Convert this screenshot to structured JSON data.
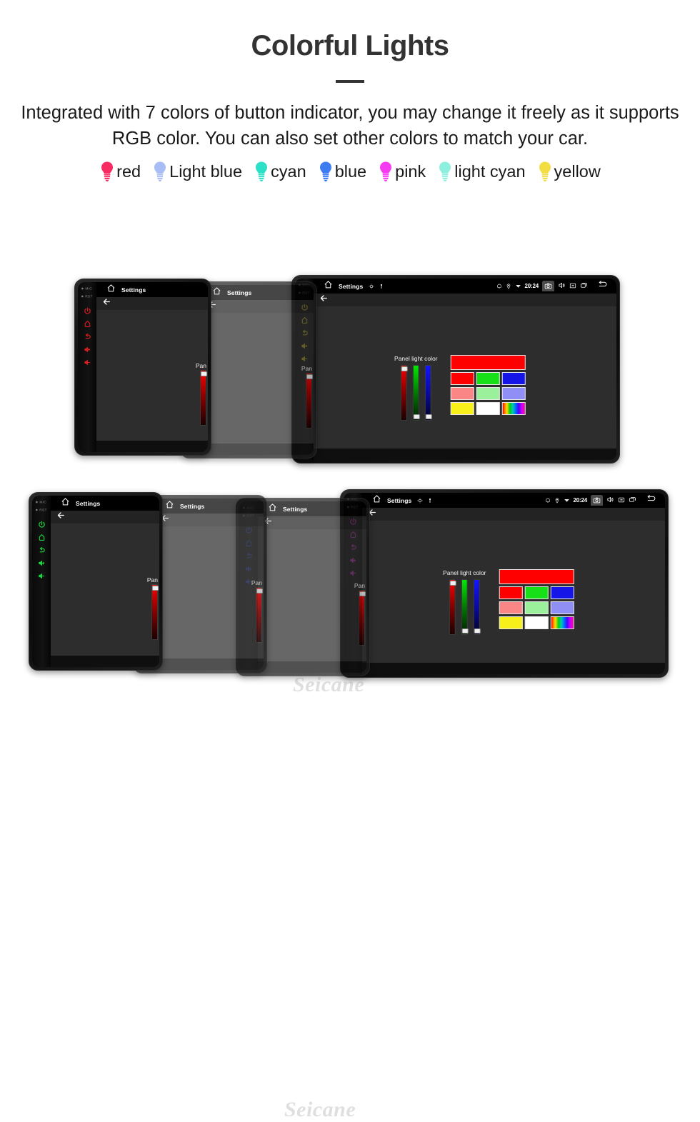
{
  "header": {
    "title": "Colorful Lights",
    "subtitle": "Integrated with 7 colors of button indicator, you may change it freely as it supports RGB color. You can also set other colors to match your car."
  },
  "legend": {
    "items": [
      {
        "label": "red",
        "color": "#f72b62",
        "icon": "bulb-icon"
      },
      {
        "label": "Light blue",
        "color": "#a8bcf5",
        "icon": "bulb-icon"
      },
      {
        "label": "cyan",
        "color": "#2ce0c8",
        "icon": "bulb-icon"
      },
      {
        "label": "blue",
        "color": "#3d7bf0",
        "icon": "bulb-icon"
      },
      {
        "label": "pink",
        "color": "#f63cf0",
        "icon": "bulb-icon"
      },
      {
        "label": "light cyan",
        "color": "#8df0de",
        "icon": "bulb-icon"
      },
      {
        "label": "yellow",
        "color": "#f2de42",
        "icon": "bulb-icon"
      }
    ]
  },
  "device": {
    "status_bar": {
      "home_icon": "home-icon",
      "title": "Settings",
      "gps_icon": "gps-icon",
      "location_icon": "location-pin-icon",
      "alarm_icon": "alarm-icon",
      "nav_icon": "nav-icon",
      "wifi_icon": "wifi-down-icon",
      "time": "20:24",
      "camera_icon": "camera-icon",
      "volume_icon": "volume-icon",
      "close_icon": "close-box-icon",
      "recents_icon": "recents-icon",
      "back_icon": "back-arrow-icon"
    },
    "sub_bar": {
      "back_icon": "back-arrow-icon"
    },
    "keys": {
      "mic_label": "MIC",
      "rst_label": "RST",
      "power_icon": "power-icon",
      "home_icon": "home-icon",
      "back_icon": "return-icon",
      "volume_up_icon": "volume-up-icon",
      "volume_down_icon": "volume-down-icon"
    },
    "panel": {
      "label": "Panel light color",
      "label_truncated": "Pan",
      "sliders": [
        {
          "name": "red",
          "value": 100,
          "color": "#fe0000"
        },
        {
          "name": "green",
          "value": 0,
          "color": "#00e900"
        },
        {
          "name": "blue",
          "value": 0,
          "color": "#1515ff"
        }
      ],
      "preview_color": "#fe0000",
      "swatch_rows": [
        [
          {
            "name": "red",
            "color": "#fe0000"
          },
          {
            "name": "green",
            "color": "#18e018"
          },
          {
            "name": "blue",
            "color": "#1515e8"
          }
        ],
        [
          {
            "name": "light-red",
            "color": "#fa8686"
          },
          {
            "name": "light-green",
            "color": "#9bf09b"
          },
          {
            "name": "light-blue",
            "color": "#8f8ff5"
          }
        ],
        [
          {
            "name": "yellow",
            "color": "#f7f01a"
          },
          {
            "name": "white",
            "color": "#ffffff"
          },
          {
            "name": "rainbow",
            "color": "rainbow"
          }
        ]
      ]
    }
  },
  "rows": [
    {
      "name": "row-1",
      "key_colors": [
        "#e01b1b",
        "#f09415",
        "#f2e016",
        "#f2e016"
      ]
    },
    {
      "name": "row-2",
      "key_colors": [
        "#18d83c",
        "#16d8a8",
        "#2a4cf0",
        "#e831d8"
      ]
    }
  ],
  "watermark": {
    "text": "Seicane"
  }
}
